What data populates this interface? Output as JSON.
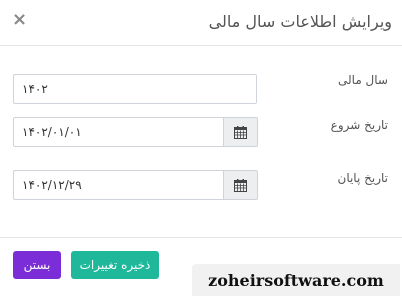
{
  "dialog": {
    "title": "ویرایش اطلاعات سال مالی",
    "close_symbol": "×"
  },
  "form": {
    "fiscal_year": {
      "label": "سال مالی",
      "value": "۱۴۰۲"
    },
    "start_date": {
      "label": "تاریخ شروع",
      "value": "۱۴۰۲/۰۱/۰۱",
      "icon": "calendar-icon"
    },
    "end_date": {
      "label": "تاریخ پایان",
      "value": "۱۴۰۲/۱۲/۲۹",
      "icon": "calendar-icon"
    }
  },
  "footer": {
    "save_label": "ذخیره تغییرات",
    "close_label": "بستن",
    "save_color": "#1fb89a",
    "close_color": "#7b2ed8"
  },
  "watermark": {
    "text": "zoheirsoftware.com"
  }
}
